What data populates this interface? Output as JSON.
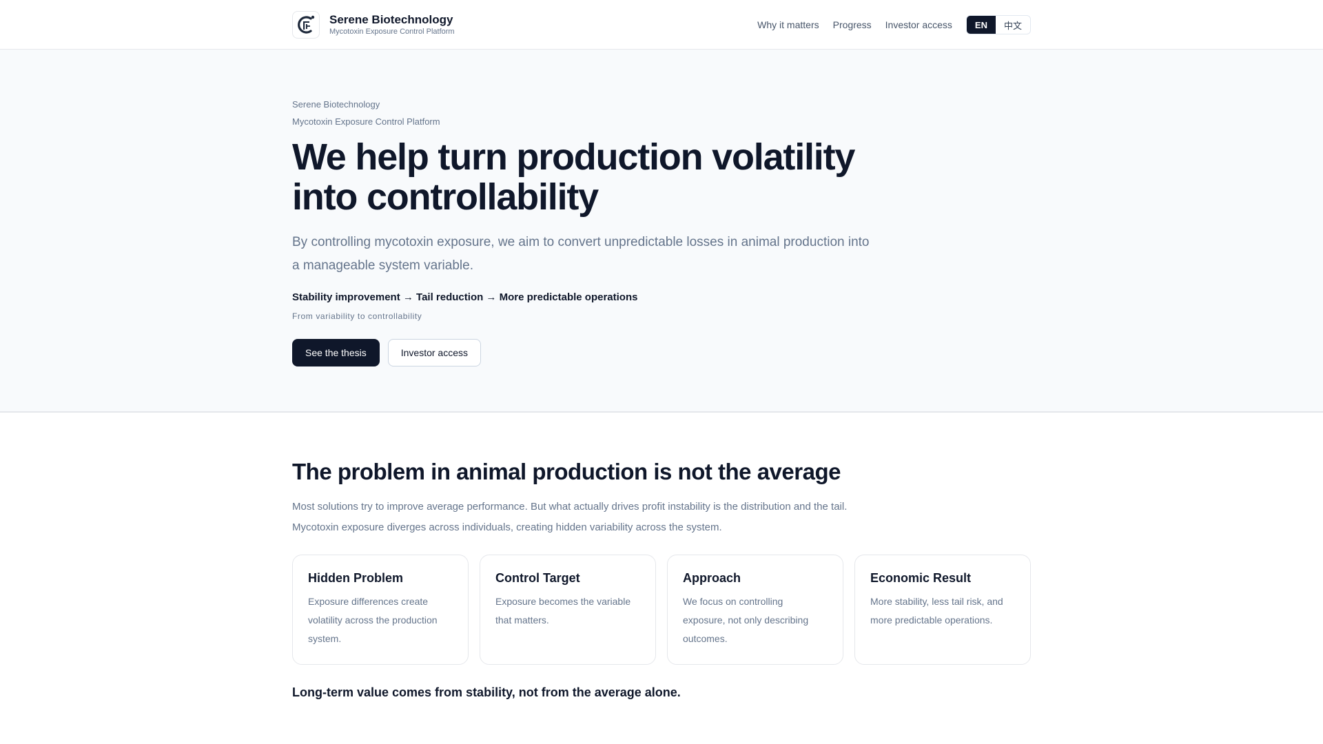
{
  "header": {
    "brand_name": "Serene Biotechnology",
    "brand_subtitle": "Mycotoxin Exposure Control Platform",
    "nav": [
      "Why it matters",
      "Progress",
      "Investor access"
    ],
    "lang_en": "EN",
    "lang_zh": "中文"
  },
  "hero": {
    "eyebrow_1": "Serene Biotechnology",
    "eyebrow_2": "Mycotoxin Exposure Control Platform",
    "title": "We help turn production volatility into controllability",
    "lead": "By controlling mycotoxin exposure, we aim to convert unpredictable losses in animal production into a manageable system variable.",
    "chain": "Stability improvement → Tail reduction → More predictable operations",
    "chain_sub": "From variability to controllability",
    "primary_button": "See the thesis",
    "secondary_button": "Investor access"
  },
  "problem": {
    "title": "The problem in animal production is not the average",
    "desc_1": "Most solutions try to improve average performance. But what actually drives profit instability is the distribution and the tail.",
    "desc_2": "Mycotoxin exposure diverges across individuals, creating hidden variability across the system.",
    "cards": [
      {
        "title": "Hidden Problem",
        "text": "Exposure differences create volatility across the production system."
      },
      {
        "title": "Control Target",
        "text": "Exposure becomes the variable that matters."
      },
      {
        "title": "Approach",
        "text": "We focus on controlling exposure, not only describing outcomes."
      },
      {
        "title": "Economic Result",
        "text": "More stability, less tail risk, and more predictable operations."
      }
    ],
    "closing": "Long-term value comes from stability, not from the average alone."
  }
}
